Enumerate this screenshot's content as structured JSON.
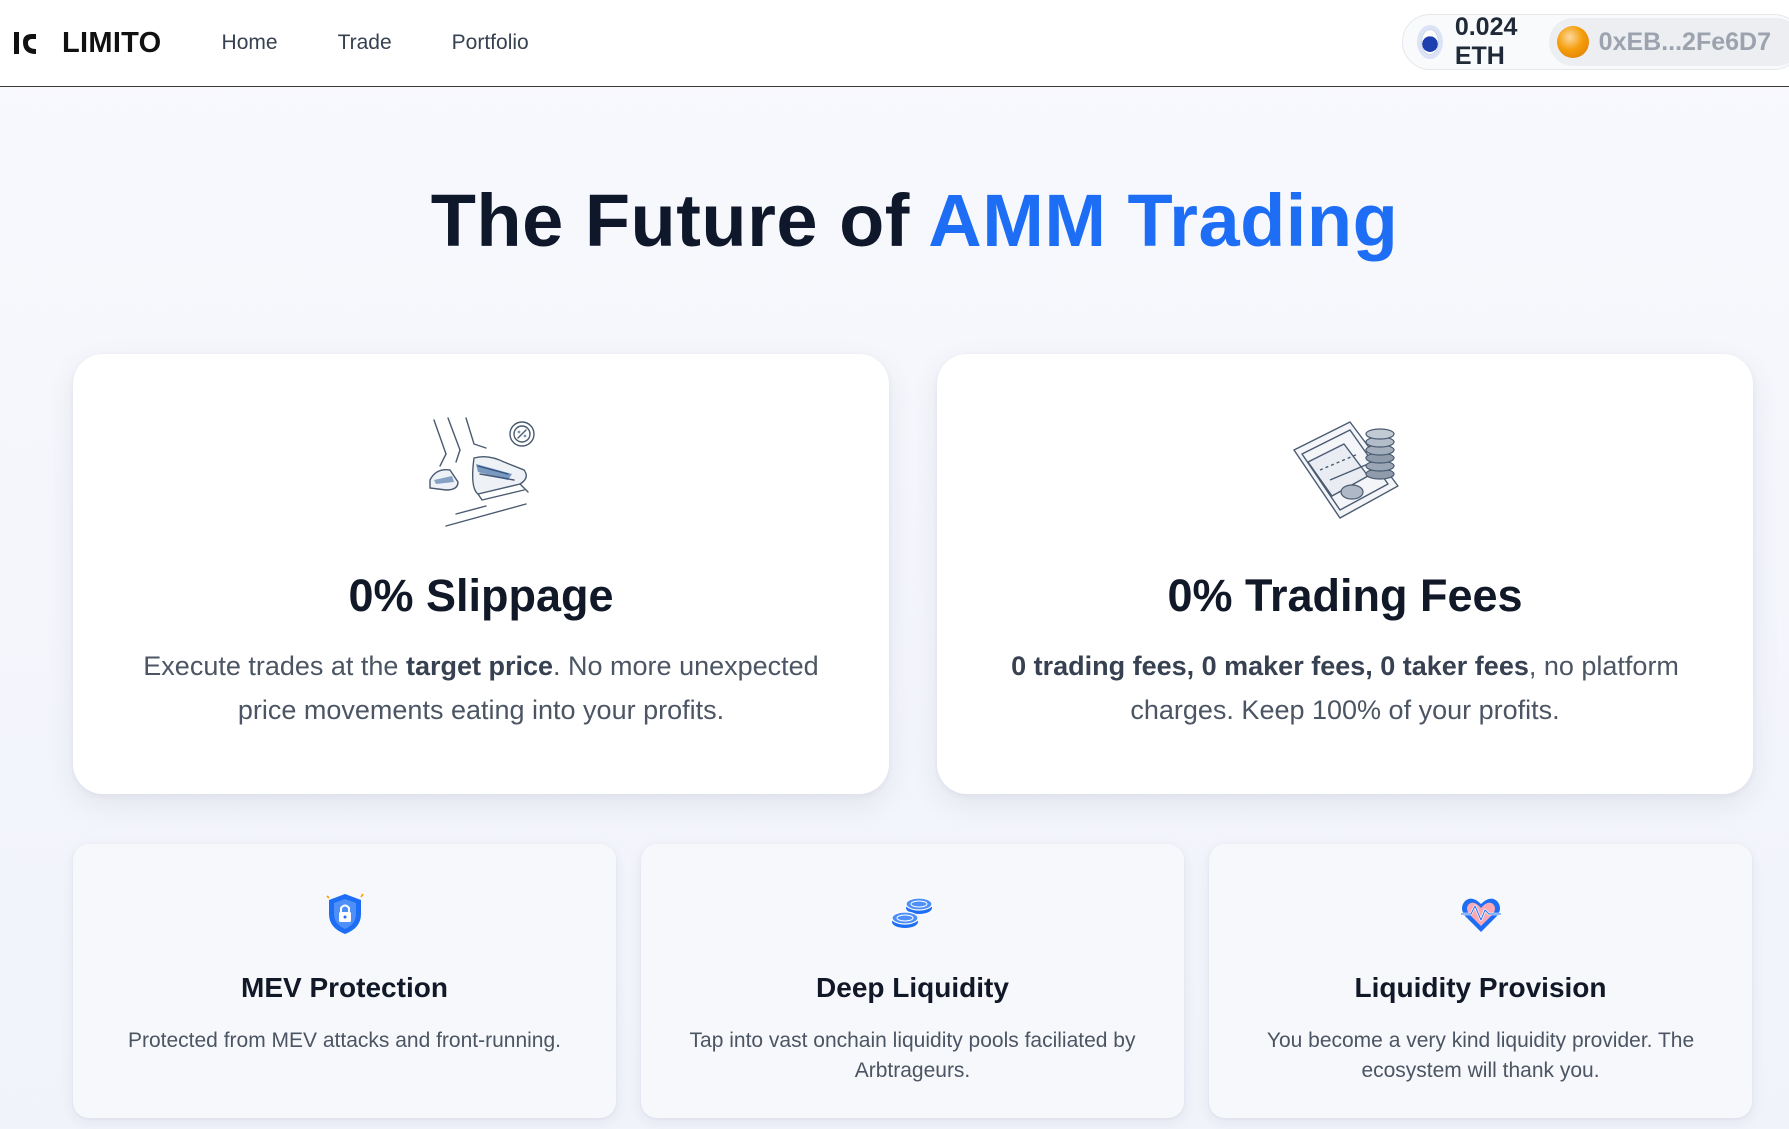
{
  "brand": {
    "name": "LIMITO",
    "logo_icon": "limito-logo-icon"
  },
  "nav": {
    "items": [
      {
        "label": "Home"
      },
      {
        "label": "Trade"
      },
      {
        "label": "Portfolio"
      }
    ]
  },
  "wallet": {
    "balance": "0.024 ETH",
    "address": "0xEB...2Fe6D7",
    "network_icon": "eth-network-icon",
    "avatar_icon": "account-avatar-icon"
  },
  "hero": {
    "title_prefix": "The Future of ",
    "title_accent": "AMM Trading"
  },
  "features_main": [
    {
      "icon": "running-shoes-illustration",
      "title": "0% Slippage",
      "desc_parts": [
        "Execute trades at the ",
        "target price",
        ". No more unexpected price movements eating into your profits."
      ]
    },
    {
      "icon": "coin-trap-illustration",
      "title": "0% Trading Fees",
      "desc_parts": [
        "0 trading fees, 0 maker fees, 0 taker fees",
        ", no platform charges. Keep 100% of your profits."
      ]
    }
  ],
  "features_secondary": [
    {
      "icon": "shield-lock-icon",
      "title": "MEV Protection",
      "desc": "Protected from MEV attacks and front-running."
    },
    {
      "icon": "coins-stack-icon",
      "title": "Deep Liquidity",
      "desc": "Tap into vast onchain liquidity pools faciliated by Arbtrageurs."
    },
    {
      "icon": "heart-pulse-icon",
      "title": "Liquidity Provision",
      "desc": "You become a very kind liquidity provider. The ecosystem will thank you."
    }
  ],
  "colors": {
    "accent": "#1d6ef5",
    "heading": "#0f172a",
    "body_text": "#4b5563"
  }
}
